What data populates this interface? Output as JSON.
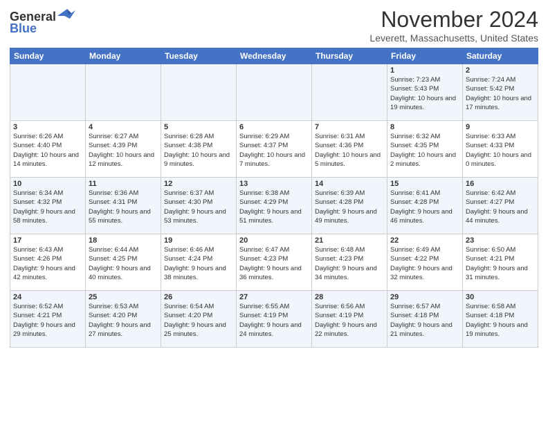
{
  "header": {
    "logo_general": "General",
    "logo_blue": "Blue",
    "month_title": "November 2024",
    "location": "Leverett, Massachusetts, United States"
  },
  "days_of_week": [
    "Sunday",
    "Monday",
    "Tuesday",
    "Wednesday",
    "Thursday",
    "Friday",
    "Saturday"
  ],
  "weeks": [
    [
      {
        "day": "",
        "info": ""
      },
      {
        "day": "",
        "info": ""
      },
      {
        "day": "",
        "info": ""
      },
      {
        "day": "",
        "info": ""
      },
      {
        "day": "",
        "info": ""
      },
      {
        "day": "1",
        "info": "Sunrise: 7:23 AM\nSunset: 5:43 PM\nDaylight: 10 hours and 19 minutes."
      },
      {
        "day": "2",
        "info": "Sunrise: 7:24 AM\nSunset: 5:42 PM\nDaylight: 10 hours and 17 minutes."
      }
    ],
    [
      {
        "day": "3",
        "info": "Sunrise: 6:26 AM\nSunset: 4:40 PM\nDaylight: 10 hours and 14 minutes."
      },
      {
        "day": "4",
        "info": "Sunrise: 6:27 AM\nSunset: 4:39 PM\nDaylight: 10 hours and 12 minutes."
      },
      {
        "day": "5",
        "info": "Sunrise: 6:28 AM\nSunset: 4:38 PM\nDaylight: 10 hours and 9 minutes."
      },
      {
        "day": "6",
        "info": "Sunrise: 6:29 AM\nSunset: 4:37 PM\nDaylight: 10 hours and 7 minutes."
      },
      {
        "day": "7",
        "info": "Sunrise: 6:31 AM\nSunset: 4:36 PM\nDaylight: 10 hours and 5 minutes."
      },
      {
        "day": "8",
        "info": "Sunrise: 6:32 AM\nSunset: 4:35 PM\nDaylight: 10 hours and 2 minutes."
      },
      {
        "day": "9",
        "info": "Sunrise: 6:33 AM\nSunset: 4:33 PM\nDaylight: 10 hours and 0 minutes."
      }
    ],
    [
      {
        "day": "10",
        "info": "Sunrise: 6:34 AM\nSunset: 4:32 PM\nDaylight: 9 hours and 58 minutes."
      },
      {
        "day": "11",
        "info": "Sunrise: 6:36 AM\nSunset: 4:31 PM\nDaylight: 9 hours and 55 minutes."
      },
      {
        "day": "12",
        "info": "Sunrise: 6:37 AM\nSunset: 4:30 PM\nDaylight: 9 hours and 53 minutes."
      },
      {
        "day": "13",
        "info": "Sunrise: 6:38 AM\nSunset: 4:29 PM\nDaylight: 9 hours and 51 minutes."
      },
      {
        "day": "14",
        "info": "Sunrise: 6:39 AM\nSunset: 4:28 PM\nDaylight: 9 hours and 49 minutes."
      },
      {
        "day": "15",
        "info": "Sunrise: 6:41 AM\nSunset: 4:28 PM\nDaylight: 9 hours and 46 minutes."
      },
      {
        "day": "16",
        "info": "Sunrise: 6:42 AM\nSunset: 4:27 PM\nDaylight: 9 hours and 44 minutes."
      }
    ],
    [
      {
        "day": "17",
        "info": "Sunrise: 6:43 AM\nSunset: 4:26 PM\nDaylight: 9 hours and 42 minutes."
      },
      {
        "day": "18",
        "info": "Sunrise: 6:44 AM\nSunset: 4:25 PM\nDaylight: 9 hours and 40 minutes."
      },
      {
        "day": "19",
        "info": "Sunrise: 6:46 AM\nSunset: 4:24 PM\nDaylight: 9 hours and 38 minutes."
      },
      {
        "day": "20",
        "info": "Sunrise: 6:47 AM\nSunset: 4:23 PM\nDaylight: 9 hours and 36 minutes."
      },
      {
        "day": "21",
        "info": "Sunrise: 6:48 AM\nSunset: 4:23 PM\nDaylight: 9 hours and 34 minutes."
      },
      {
        "day": "22",
        "info": "Sunrise: 6:49 AM\nSunset: 4:22 PM\nDaylight: 9 hours and 32 minutes."
      },
      {
        "day": "23",
        "info": "Sunrise: 6:50 AM\nSunset: 4:21 PM\nDaylight: 9 hours and 31 minutes."
      }
    ],
    [
      {
        "day": "24",
        "info": "Sunrise: 6:52 AM\nSunset: 4:21 PM\nDaylight: 9 hours and 29 minutes."
      },
      {
        "day": "25",
        "info": "Sunrise: 6:53 AM\nSunset: 4:20 PM\nDaylight: 9 hours and 27 minutes."
      },
      {
        "day": "26",
        "info": "Sunrise: 6:54 AM\nSunset: 4:20 PM\nDaylight: 9 hours and 25 minutes."
      },
      {
        "day": "27",
        "info": "Sunrise: 6:55 AM\nSunset: 4:19 PM\nDaylight: 9 hours and 24 minutes."
      },
      {
        "day": "28",
        "info": "Sunrise: 6:56 AM\nSunset: 4:19 PM\nDaylight: 9 hours and 22 minutes."
      },
      {
        "day": "29",
        "info": "Sunrise: 6:57 AM\nSunset: 4:18 PM\nDaylight: 9 hours and 21 minutes."
      },
      {
        "day": "30",
        "info": "Sunrise: 6:58 AM\nSunset: 4:18 PM\nDaylight: 9 hours and 19 minutes."
      }
    ]
  ]
}
